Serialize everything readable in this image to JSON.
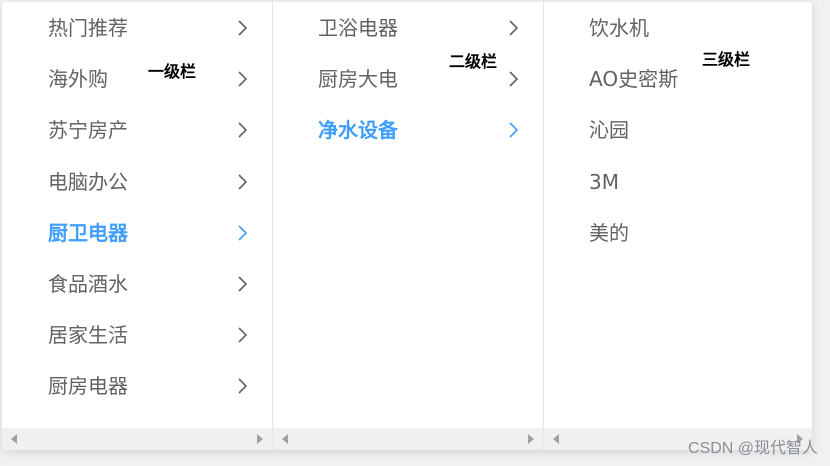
{
  "columns": [
    {
      "note": "一级栏",
      "items": [
        {
          "label": "热门推荐",
          "has_children": true,
          "active": false
        },
        {
          "label": "海外购",
          "has_children": true,
          "active": false
        },
        {
          "label": "苏宁房产",
          "has_children": true,
          "active": false
        },
        {
          "label": "电脑办公",
          "has_children": true,
          "active": false
        },
        {
          "label": "厨卫电器",
          "has_children": true,
          "active": true
        },
        {
          "label": "食品酒水",
          "has_children": true,
          "active": false
        },
        {
          "label": "居家生活",
          "has_children": true,
          "active": false
        },
        {
          "label": "厨房电器",
          "has_children": true,
          "active": false
        }
      ]
    },
    {
      "note": "二级栏",
      "items": [
        {
          "label": "卫浴电器",
          "has_children": true,
          "active": false
        },
        {
          "label": "厨房大电",
          "has_children": true,
          "active": false
        },
        {
          "label": "净水设备",
          "has_children": true,
          "active": true
        }
      ]
    },
    {
      "note": "三级栏",
      "items": [
        {
          "label": "饮水机",
          "has_children": false,
          "active": false
        },
        {
          "label": "AO史密斯",
          "has_children": false,
          "active": false
        },
        {
          "label": "沁园",
          "has_children": false,
          "active": false
        },
        {
          "label": "3M",
          "has_children": false,
          "active": false
        },
        {
          "label": "美的",
          "has_children": false,
          "active": false
        }
      ]
    }
  ],
  "watermark": "CSDN @现代智人",
  "colors": {
    "active": "#409eff",
    "text": "#606266",
    "chevron": "#606266"
  },
  "icons": {
    "expand": "chevron-right-icon"
  }
}
